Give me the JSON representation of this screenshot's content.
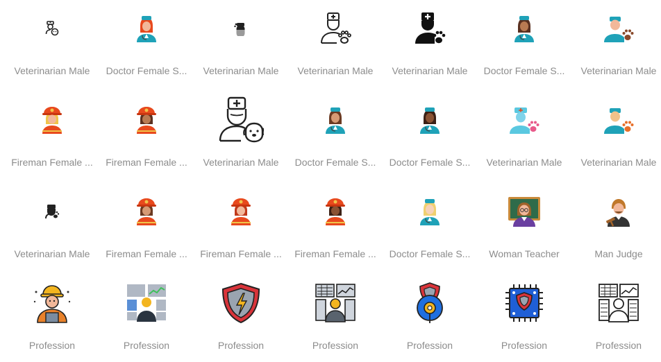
{
  "icons": [
    {
      "label": "Veterinarian Male",
      "icon": "veterinarian-male-outline-small-icon"
    },
    {
      "label": "Doctor Female S...",
      "icon": "doctor-female-color-icon"
    },
    {
      "label": "Veterinarian Male",
      "icon": "veterinarian-male-glyph-small-icon"
    },
    {
      "label": "Veterinarian Male",
      "icon": "veterinarian-male-outline-icon"
    },
    {
      "label": "Veterinarian Male",
      "icon": "veterinarian-male-solid-icon"
    },
    {
      "label": "Doctor Female S...",
      "icon": "doctor-female-color-icon"
    },
    {
      "label": "Veterinarian Male",
      "icon": "veterinarian-male-color-icon"
    },
    {
      "label": "Fireman Female ...",
      "icon": "fireman-female-color-icon"
    },
    {
      "label": "Fireman Female ...",
      "icon": "fireman-female-color-icon"
    },
    {
      "label": "Veterinarian Male",
      "icon": "veterinarian-male-outline-large-icon"
    },
    {
      "label": "Doctor Female S...",
      "icon": "doctor-female-color-icon"
    },
    {
      "label": "Doctor Female S...",
      "icon": "doctor-female-color-icon"
    },
    {
      "label": "Veterinarian Male",
      "icon": "veterinarian-male-blue-icon"
    },
    {
      "label": "Veterinarian Male",
      "icon": "veterinarian-male-color-icon"
    },
    {
      "label": "Veterinarian Male",
      "icon": "veterinarian-male-glyph-small-icon"
    },
    {
      "label": "Fireman Female ...",
      "icon": "fireman-female-color-icon"
    },
    {
      "label": "Fireman Female ...",
      "icon": "fireman-female-color-icon"
    },
    {
      "label": "Fireman Female ...",
      "icon": "fireman-female-color-icon"
    },
    {
      "label": "Doctor Female S...",
      "icon": "doctor-female-color-icon"
    },
    {
      "label": "Woman Teacher",
      "icon": "woman-teacher-icon"
    },
    {
      "label": "Man Judge",
      "icon": "man-judge-icon"
    },
    {
      "label": "Profession",
      "icon": "construction-worker-icon"
    },
    {
      "label": "Profession",
      "icon": "trader-dashboard-color-icon"
    },
    {
      "label": "Profession",
      "icon": "security-shield-icon"
    },
    {
      "label": "Profession",
      "icon": "trader-dashboard-lineal-color-icon"
    },
    {
      "label": "Profession",
      "icon": "security-badge-location-icon"
    },
    {
      "label": "Profession",
      "icon": "cyber-security-chip-icon"
    },
    {
      "label": "Profession",
      "icon": "trader-dashboard-outline-icon"
    }
  ],
  "colors": {
    "label": "#8c8c8c",
    "skin": "#f2b89a",
    "skin_dark": "#a0623e",
    "teal": "#1fa2b8",
    "orange_red": "#e8491d",
    "paw": "#8a4a2b"
  }
}
